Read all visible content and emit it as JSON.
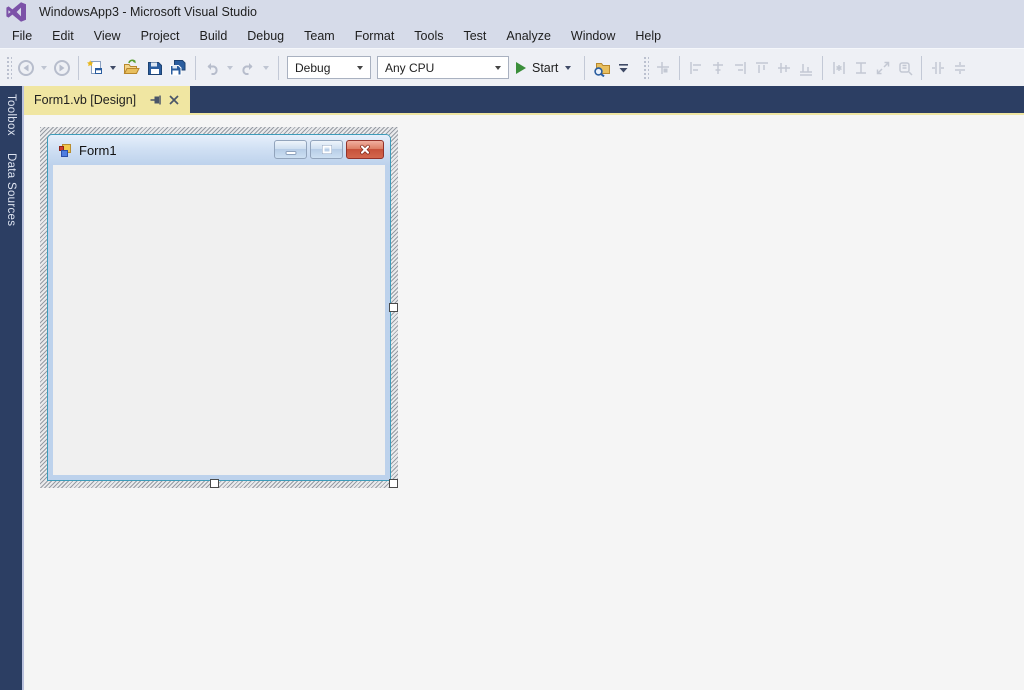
{
  "window": {
    "title": "WindowsApp3 - Microsoft Visual Studio"
  },
  "menubar": {
    "items": [
      "File",
      "Edit",
      "View",
      "Project",
      "Build",
      "Debug",
      "Team",
      "Format",
      "Tools",
      "Test",
      "Analyze",
      "Window",
      "Help"
    ]
  },
  "toolbar": {
    "configuration": "Debug",
    "platform": "Any CPU",
    "start_label": "Start",
    "standard_icons": [
      "back-icon",
      "forward-icon",
      "new-project-icon",
      "open-file-icon",
      "save-icon",
      "save-all-icon",
      "undo-icon",
      "redo-icon",
      "solution-explorer-search-icon",
      "toolbar-overflow-icon"
    ],
    "layout_icons": [
      "align-to-grid-icon",
      "align-lefts-icon",
      "align-centers-icon",
      "align-rights-icon",
      "align-tops-icon",
      "align-middles-icon",
      "align-bottoms-icon",
      "make-same-width-icon",
      "make-same-height-icon",
      "make-same-size-icon",
      "size-to-grid-icon",
      "horizontal-spacing-icon",
      "vertical-spacing-icon"
    ]
  },
  "document_tabs": {
    "active_tab": {
      "label": "Form1.vb [Design]",
      "icons": [
        "pin-icon",
        "close-icon"
      ]
    }
  },
  "side_tabs": {
    "items": [
      "Toolbox",
      "Data Sources"
    ]
  },
  "designer": {
    "form": {
      "title": "Form1",
      "caption_buttons": [
        "minimize-icon",
        "maximize-icon",
        "close-icon"
      ]
    }
  },
  "colors": {
    "vs_purple": "#7c52a8",
    "top_bg": "#d6dbe9",
    "toolbar_bg": "#eef0f5",
    "dock_bg": "#2c3e63",
    "active_tab_bg": "#f0e6a2",
    "editor_bg": "#f5f5f5",
    "form_frame": "#bdd2ec",
    "form_border_teal": "#3d9cba",
    "form_client": "#f0f0f0",
    "close_red": "#c6513a",
    "start_green": "#3a8e3a",
    "save_blue": "#2a5d9f",
    "folder_gold": "#dfa944",
    "disabled_icon": "#c3c8d3"
  }
}
